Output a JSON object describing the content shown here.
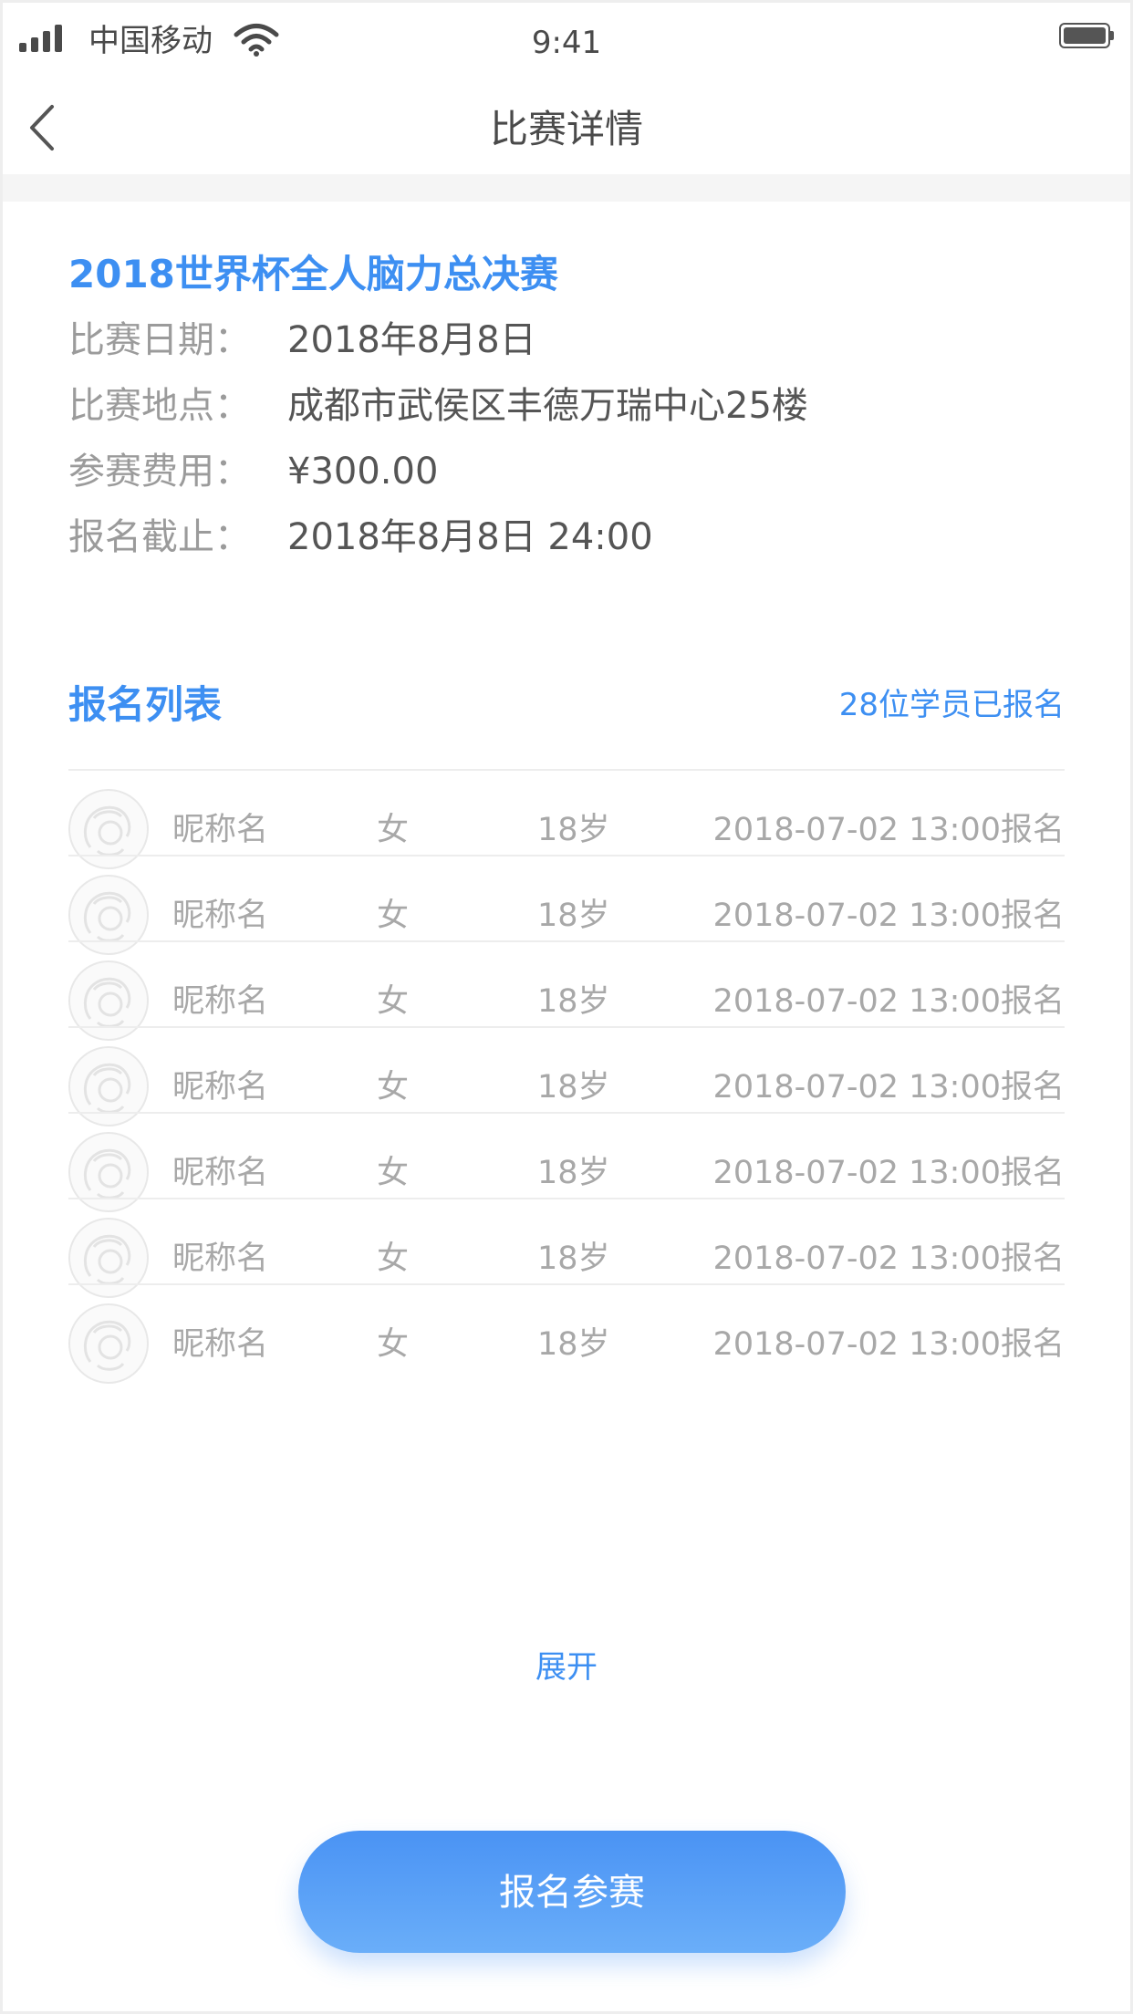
{
  "status_bar": {
    "carrier": "中国移动",
    "time": "9:41",
    "signal_bars": 4,
    "battery_level": 1.0
  },
  "nav": {
    "title": "比赛详情",
    "back_icon": "chevron-left-icon"
  },
  "event": {
    "title": "2018世界杯全人脑力总决赛",
    "info": [
      {
        "label": "比赛日期：",
        "value": "2018年8月8日"
      },
      {
        "label": "比赛地点：",
        "value": "成都市武侯区丰德万瑞中心25楼"
      },
      {
        "label": "参赛费用：",
        "value": "¥300.00"
      },
      {
        "label": "报名截止：",
        "value": "2018年8月8日 24:00"
      }
    ]
  },
  "signup_list": {
    "title": "报名列表",
    "count_text": "28位学员已报名",
    "rows": [
      {
        "name": "昵称名",
        "gender": "女",
        "age": "18岁",
        "time": "2018-07-02 13:00报名"
      },
      {
        "name": "昵称名",
        "gender": "女",
        "age": "18岁",
        "time": "2018-07-02 13:00报名"
      },
      {
        "name": "昵称名",
        "gender": "女",
        "age": "18岁",
        "time": "2018-07-02 13:00报名"
      },
      {
        "name": "昵称名",
        "gender": "女",
        "age": "18岁",
        "time": "2018-07-02 13:00报名"
      },
      {
        "name": "昵称名",
        "gender": "女",
        "age": "18岁",
        "time": "2018-07-02 13:00报名"
      },
      {
        "name": "昵称名",
        "gender": "女",
        "age": "18岁",
        "time": "2018-07-02 13:00报名"
      },
      {
        "name": "昵称名",
        "gender": "女",
        "age": "18岁",
        "time": "2018-07-02 13:00报名"
      }
    ],
    "expand_label": "展开"
  },
  "action": {
    "signup_label": "报名参赛"
  },
  "colors": {
    "accent": "#3d8ff2",
    "button_gradient_start": "#4a93f4",
    "button_gradient_end": "#6aaef9",
    "label_gray": "#9b9b9b",
    "value_gray": "#555555",
    "row_text_gray": "#a8a8a8"
  }
}
